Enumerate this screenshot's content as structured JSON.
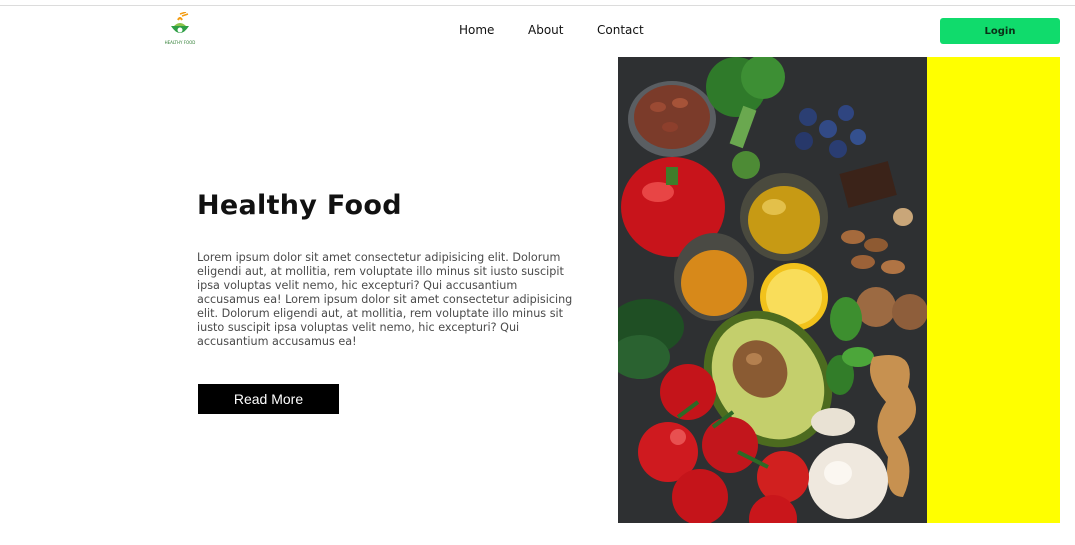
{
  "brand": {
    "logo_text": "HEALTHY FOOD"
  },
  "nav": {
    "items": [
      {
        "label": "Home"
      },
      {
        "label": "About"
      },
      {
        "label": "Contact"
      }
    ],
    "login_label": "Login"
  },
  "hero": {
    "title": "Healthy Food",
    "body": "Lorem ipsum dolor sit amet consectetur adipisicing elit. Dolorum eligendi aut, at mollitia, rem voluptate illo minus sit iusto suscipit ipsa voluptas velit nemo, hic excepturi? Qui accusantium accusamus ea! Lorem ipsum dolor sit amet consectetur adipisicing elit. Dolorum eligendi aut, at mollitia, rem voluptate illo minus sit iusto suscipit ipsa voluptas velit nemo, hic excepturi? Qui accusantium accusamus ea!",
    "read_more_label": "Read More"
  },
  "colors": {
    "login_button": "#10db6c",
    "read_more_button": "#000000",
    "side_panel": "#ffff00",
    "image_background": "#2f3133"
  }
}
